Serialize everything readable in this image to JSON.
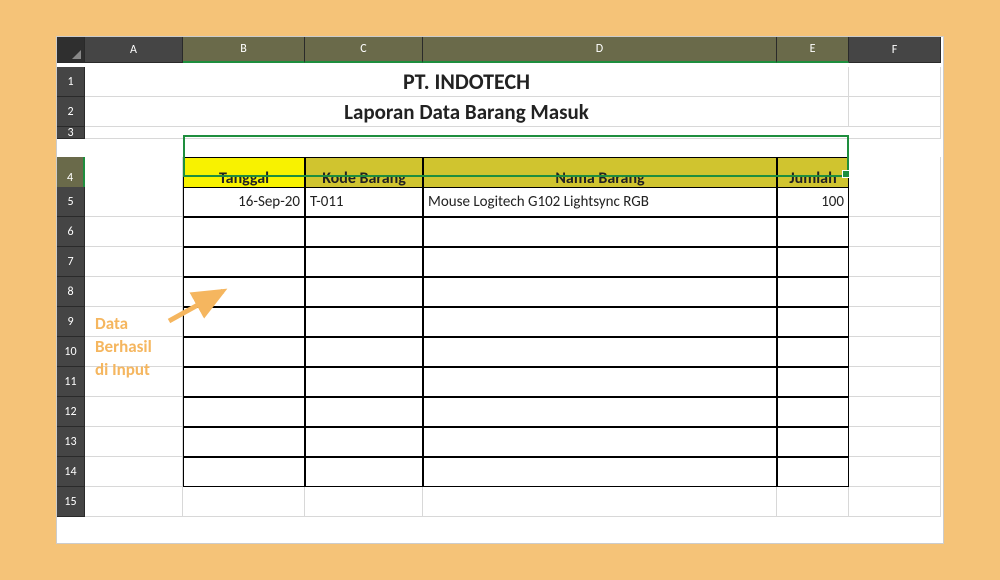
{
  "columns": [
    "A",
    "B",
    "C",
    "D",
    "E",
    "F"
  ],
  "selected_columns": [
    "B",
    "C",
    "D",
    "E"
  ],
  "rows": [
    1,
    2,
    3,
    4,
    5,
    6,
    7,
    8,
    9,
    10,
    11,
    12,
    13,
    14,
    15
  ],
  "selected_row": 4,
  "title1": "PT. INDOTECH",
  "title2": "Laporan Data Barang Masuk",
  "headers": {
    "tanggal": "Tanggal",
    "kode": "Kode Barang",
    "nama": "Nama Barang",
    "jumlah": "Jumlah"
  },
  "data_row": {
    "tanggal": "16-Sep-20",
    "kode": "T-011",
    "nama": "Mouse Logitech G102 Lightsync RGB",
    "jumlah": "100"
  },
  "empty_rows": 9,
  "annotation": "Data\nBerhasil\ndi Input",
  "chart_data": {
    "type": "table",
    "title": "Laporan Data Barang Masuk",
    "columns": [
      "Tanggal",
      "Kode Barang",
      "Nama Barang",
      "Jumlah"
    ],
    "rows": [
      [
        "16-Sep-20",
        "T-011",
        "Mouse Logitech G102 Lightsync RGB",
        100
      ]
    ]
  }
}
